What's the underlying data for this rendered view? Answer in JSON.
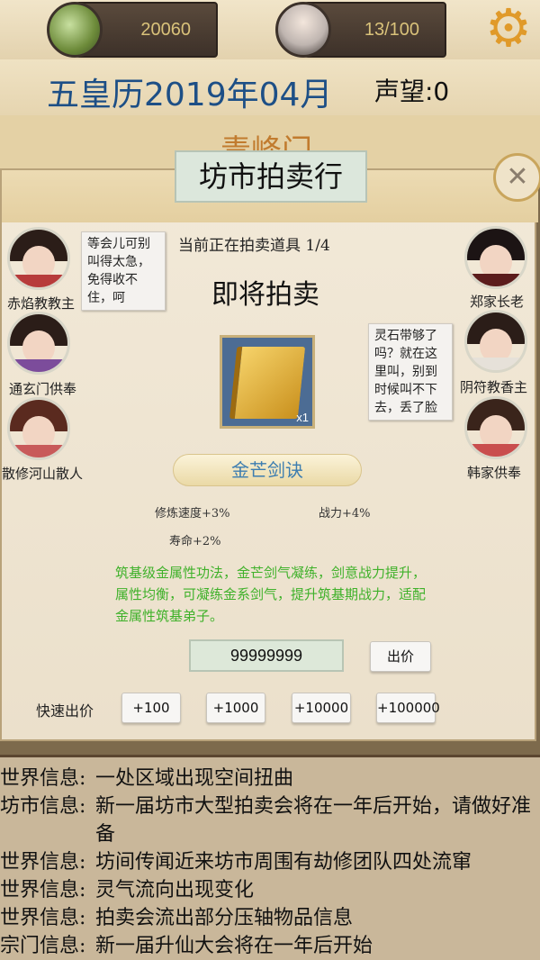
{
  "topbar": {
    "spirit_stones": "20060",
    "disciples": "13/100",
    "icons": [
      "jade-icon",
      "disciples-icon",
      "gear-icon"
    ]
  },
  "header": {
    "date": "五皇历2019年04月",
    "fame": "声望:0"
  },
  "sect": {
    "title": "青峰门"
  },
  "auction": {
    "title": "坊市拍卖行",
    "status": "当前正在拍卖道具 1/4",
    "state": "即将拍卖",
    "item": {
      "name": "金芒剑诀",
      "quantity": "x1",
      "stats": {
        "speed": "修炼速度+3%",
        "power": "战力+4%",
        "life": "寿命+2%"
      },
      "description": "筑基级金属性功法，金芒剑气凝练，剑意战力提升，属性均衡，可凝练金系剑气，提升筑基期战力，适配金属性筑基弟子。"
    },
    "bid_value": "99999999",
    "bid_button": "出价",
    "quick_label": "快速出价",
    "quick_buttons": [
      "+100",
      "+1000",
      "+10000",
      "+100000"
    ]
  },
  "npcs_left": [
    {
      "name": "赤焰教教主",
      "bubble": "等会儿可别叫得太急，免得收不住，呵"
    },
    {
      "name": "通玄门供奉"
    },
    {
      "name": "散修河山散人"
    }
  ],
  "npcs_right": [
    {
      "name": "郑家长老"
    },
    {
      "name": "阴符教香主",
      "bubble": "灵石带够了吗？就在这里叫，别到时候叫不下去，丢了脸"
    },
    {
      "name": "韩家供奉"
    }
  ],
  "messages": [
    {
      "category": "世界信息:",
      "text": "一处区域出现空间扭曲"
    },
    {
      "category": "坊市信息:",
      "text": "新一届坊市大型拍卖会将在一年后开始，请做好准备"
    },
    {
      "category": "世界信息:",
      "text": "坊间传闻近来坊市周围有劫修团队四处流窜"
    },
    {
      "category": "世界信息:",
      "text": "灵气流向出现变化"
    },
    {
      "category": "世界信息:",
      "text": "拍卖会流出部分压轴物品信息"
    },
    {
      "category": "宗门信息:",
      "text": "新一届升仙大会将在一年后开始"
    }
  ],
  "colors": {
    "date": "#1d4f86",
    "item_name": "#3d7db0",
    "description": "#3fb12a",
    "gear": "#e09a2a"
  }
}
